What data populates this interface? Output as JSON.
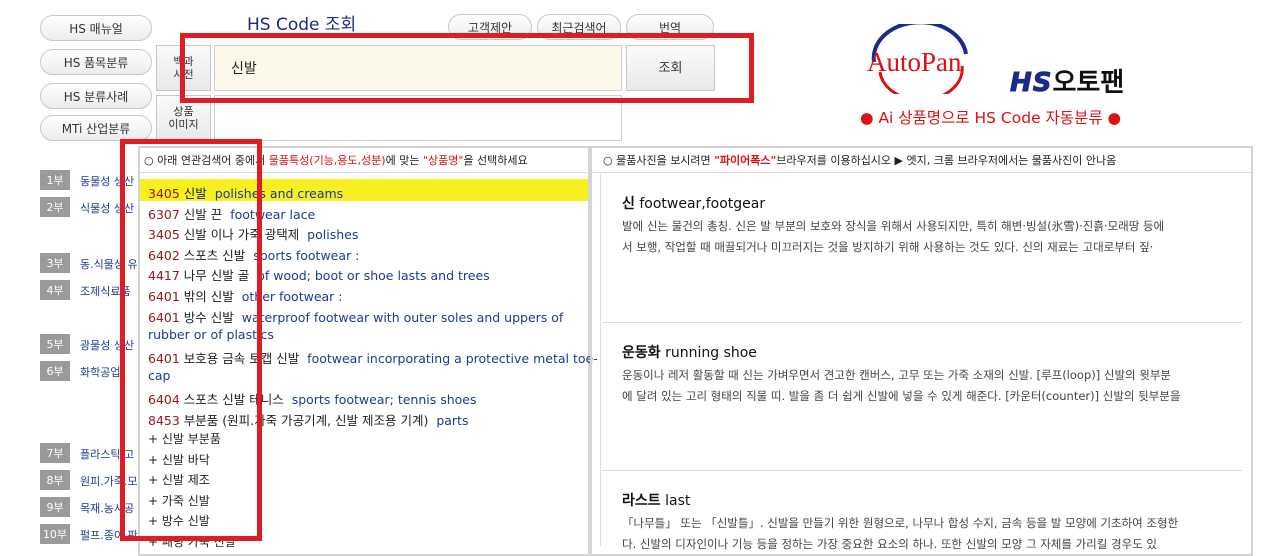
{
  "left_nav": [
    "HS 매뉴얼",
    "HS 품목분류",
    "HS 분류사례",
    "MTi 산업분류"
  ],
  "page_title": "HS Code 조회",
  "top_buttons": [
    "고객제안",
    "최근검색어",
    "번역"
  ],
  "side_buttons": {
    "dictionary": "백과\n사전",
    "image": "상품\n이미지"
  },
  "search": {
    "value": "신발",
    "button": "조회"
  },
  "brand": {
    "logo": "AutoPan",
    "hs": "HS",
    "name": "오토팬",
    "tagline": "● Ai 상품명으로 HS Code 자동분류 ●"
  },
  "parts": [
    {
      "num": "1부",
      "label": "동물성 생산"
    },
    {
      "num": "2부",
      "label": "식물성 생산"
    },
    {
      "num": "3부",
      "label": "동.식물성 유"
    },
    {
      "num": "4부",
      "label": "조제식료품"
    },
    {
      "num": "5부",
      "label": "광물성 생산"
    },
    {
      "num": "6부",
      "label": "화학공업"
    },
    {
      "num": "7부",
      "label": "플라스틱.고"
    },
    {
      "num": "8부",
      "label": "원피.가죽.모"
    },
    {
      "num": "9부",
      "label": "목재.농사공"
    },
    {
      "num": "10부",
      "label": "펄프.종이.판"
    }
  ],
  "results_header": {
    "prefix": "○ 아래 연관검색어 중에서 ",
    "red": "물품특성(기능,용도,성분)",
    "mid": "에 맞는 ",
    "quote": "\"상품명\"",
    "suffix": "을 선택하세요"
  },
  "results": [
    {
      "code": "3405",
      "kr": "신발",
      "en": "polishes and creams"
    },
    {
      "code": "6307",
      "kr": "신발 끈",
      "en": "footwear lace"
    },
    {
      "code": "3405",
      "kr": "신발 이나 가죽 광택제",
      "en": "polishes"
    },
    {
      "code": "6402",
      "kr": "스포츠 신발",
      "en": "sports footwear :"
    },
    {
      "code": "4417",
      "kr": "나무 신발 골",
      "en": "of wood; boot or shoe lasts and trees"
    },
    {
      "code": "6401",
      "kr": "밖의 신발",
      "en": "other footwear :"
    },
    {
      "code": "6401",
      "kr": "방수 신발",
      "en": "waterproof footwear with outer soles and uppers of",
      "en2": "rubber or of plastics"
    },
    {
      "code": "6401",
      "kr": "보호용 금속 토캡 신발",
      "en": "footwear incorporating a protective metal toe-",
      "en2": "cap"
    },
    {
      "code": "6404",
      "kr": "스포츠 신발 테니스",
      "en": "sports footwear; tennis shoes"
    },
    {
      "code": "8453",
      "kr": "부분품 (원피.가죽 가공기계, 신발 제조용 기계)",
      "en": "parts"
    }
  ],
  "expand_items": [
    "+ 신발 부분품",
    "+ 신발 바닥",
    "+ 신발 제조",
    "+ 가죽 신발",
    "+ 방수 신발",
    "+ 패딩 가죽 신발"
  ],
  "dict_header": {
    "prefix": "○ 물품사진을 보시려면 ",
    "red": "\"파이어폭스\"",
    "suffix": "브라우저를 이용하십시오 ▶ 엣지, 크롬 브라우저에서는 물품사진이 안나옴"
  },
  "dict": [
    {
      "kr": "신",
      "en": "footwear,footgear",
      "lines": [
        "발에 신는 물건의 총칭. 신은 발 부분의 보호와 장식을 위해서 사용되지만, 특히 해변·빙설(氷雪)·진흙·모래땅 등에",
        "서 보행, 작업할 때 매끌되거나 미끄러지는 것을 방지하기 위해 사용하는 것도 있다. 신의 재료는 고대로부터 짚·"
      ]
    },
    {
      "kr": "운동화",
      "en": "running shoe",
      "lines": [
        "운동이나 레저 활동할 때 신는 가벼우면서 견고한 캔버스, 고무 또는 가죽 소재의 신발. [루프(loop)] 신발의 윗부분",
        "에 달려 있는 고리 형태의 직물 띠. 발을 좀 더 쉽게 신발에 넣을 수 있게 해준다. [카운터(counter)] 신발의 뒷부분을"
      ]
    },
    {
      "kr": "라스트",
      "en": "last",
      "lines": [
        "「나무틀」 또는 「신발틀」. 신발을 만들기 위한 원형으로, 나무나 합성 수지, 금속 등을 발 모양에 기초하여 조형한",
        "다. 신발의 디자인이나 기능 등을 정하는 가장 중요한 요소의 하나. 또한 신발의 모양 그 자체를 가리킬 경우도 있"
      ]
    }
  ],
  "colors": {
    "accent_red": "#e01c24",
    "highlight": "#f7ef1f",
    "title_blue": "#1a2a8c",
    "code_red": "#8e1b1b"
  }
}
